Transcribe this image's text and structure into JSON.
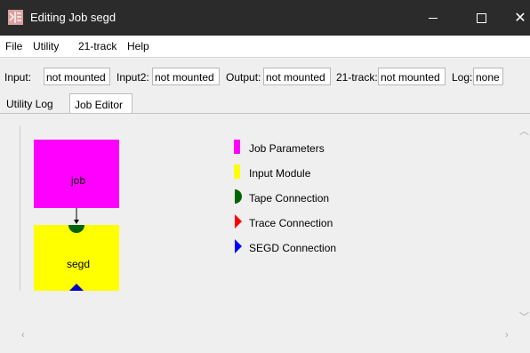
{
  "window": {
    "title": "Editing Job segd",
    "minimize_symbol": "—",
    "close_symbol": "✕"
  },
  "menu": {
    "items": [
      {
        "label": "File"
      },
      {
        "label": "Utility"
      },
      {
        "label": "21-track"
      },
      {
        "label": "Help"
      }
    ]
  },
  "status": {
    "input_label": "Input:",
    "input_value": "not mounted",
    "input2_label": "Input2:",
    "input2_value": "not mounted",
    "output_label": "Output:",
    "output_value": "not mounted",
    "track21_label": "21-track:",
    "track21_value": "not mounted",
    "log_label": "Log:",
    "log_value": "none"
  },
  "tabs": [
    {
      "label": "Utility Log",
      "active": false
    },
    {
      "label": "Job Editor",
      "active": true
    }
  ],
  "diagram": {
    "job_block": {
      "label": "job",
      "color": "#ff00ff"
    },
    "segd_block": {
      "label": "segd",
      "color": "#ffff00"
    }
  },
  "legend": [
    {
      "label": "Job Parameters",
      "color": "#ff00ff",
      "icon": "rectangle-swatch"
    },
    {
      "label": "Input Module",
      "color": "#ffff00",
      "icon": "rectangle-swatch"
    },
    {
      "label": "Tape Connection",
      "color": "#006400",
      "icon": "half-circle"
    },
    {
      "label": "Trace Connection",
      "color": "#ff0000",
      "icon": "right-triangle"
    },
    {
      "label": "SEGD Connection",
      "color": "#0000ff",
      "icon": "right-triangle"
    }
  ],
  "colors": {
    "titlebar": "#2b2b2b",
    "tape_connection": "#006400",
    "segd_connection": "#0000ff"
  }
}
